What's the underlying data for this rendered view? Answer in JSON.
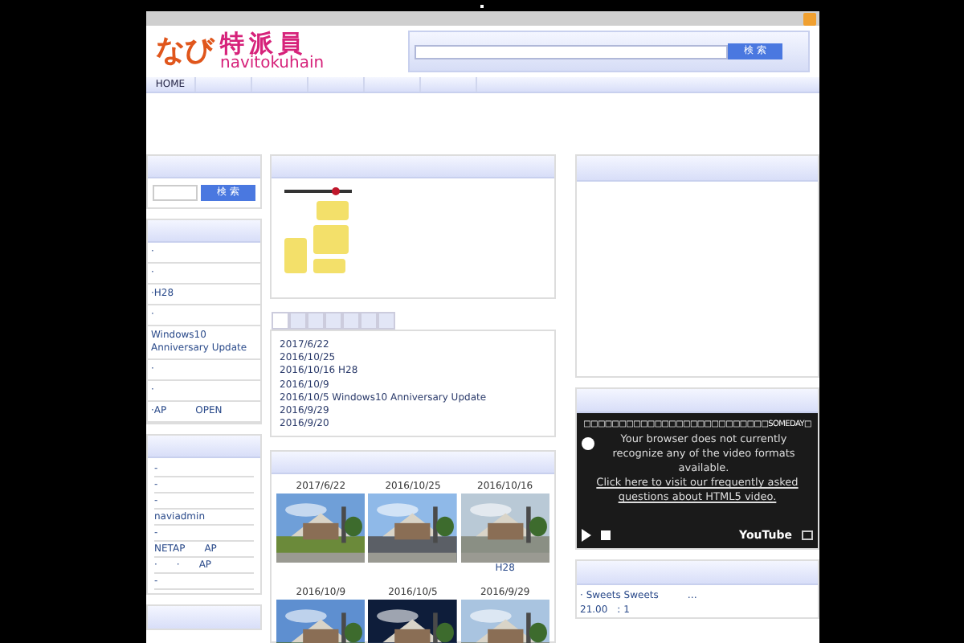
{
  "header": {
    "logo_kana": "なび",
    "logo_kanji": "特派員",
    "logo_roman": "navitokuhain",
    "search_button": "検 索"
  },
  "nav": {
    "items": [
      {
        "label": "HOME",
        "selected": false
      }
    ]
  },
  "left": {
    "search_button": "検 索",
    "list": [
      "·",
      "·",
      "·H28",
      "·",
      "Windows10 Anniversary Update",
      "·",
      "·",
      "·AP　　　OPEN"
    ],
    "box2": [
      "-",
      "-",
      "-",
      "naviadmin",
      "-",
      "NETAP　　AP",
      "·　　·　　AP",
      "-"
    ]
  },
  "center": {
    "tabs": [
      {
        "selected": true
      },
      {
        "selected": false
      },
      {
        "selected": false
      },
      {
        "selected": false
      },
      {
        "selected": false
      },
      {
        "selected": false
      },
      {
        "selected": false
      }
    ],
    "news": [
      "2017/6/22",
      "2016/10/25",
      "2016/10/16 H28",
      "2016/10/9",
      "2016/10/5 Windows10 Anniversary Update",
      "2016/9/29",
      "2016/9/20"
    ],
    "photos": [
      {
        "date": "2017/6/22"
      },
      {
        "date": "2016/10/25"
      },
      {
        "date": "2016/10/16",
        "caption": "H28"
      },
      {
        "date": "2016/10/9"
      },
      {
        "date": "2016/10/5"
      },
      {
        "date": "2016/9/29"
      }
    ]
  },
  "right": {
    "video": {
      "title": "□□□□□□□□□□□□□□□□□□□□□□□□□□SOMEDAY□",
      "message": "Your browser does not currently recognize any of the video formats available.",
      "link": "Click here to visit our frequently asked questions about HTML5 video.",
      "brand": "YouTube"
    },
    "list": [
      "· Sweets Sweets　　　…",
      "21.00　: 1"
    ]
  }
}
